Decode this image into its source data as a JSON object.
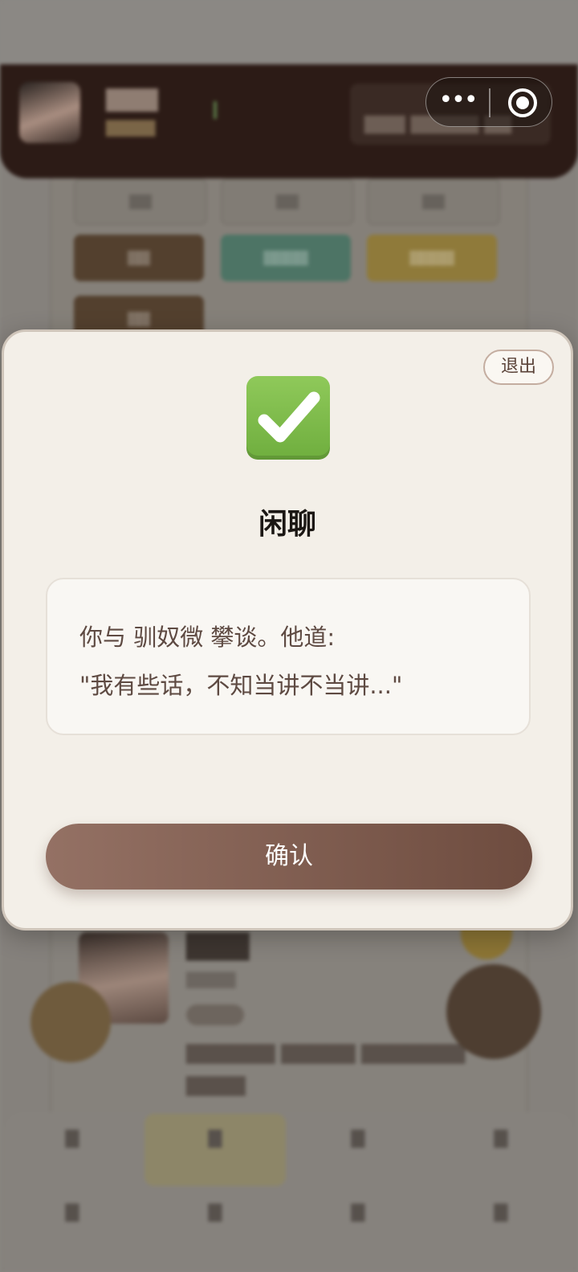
{
  "modal": {
    "exit_label": "退出",
    "icon": "check-mark-icon",
    "title": "闲聊",
    "message_line1": "你与 驯奴微 攀谈。他道:",
    "message_line2": "\"我有些话，不知当讲不当讲...\"",
    "confirm_label": "确认"
  },
  "capsule": {
    "more_glyph": "•••",
    "icons": [
      "more-icon",
      "close-miniprogram-icon"
    ]
  },
  "colors": {
    "modal_bg": "#f3efe8",
    "confirm_start": "#947164",
    "confirm_end": "#6e4c3f",
    "text_brown": "#5e4a42",
    "check_green": "#7ab648"
  }
}
